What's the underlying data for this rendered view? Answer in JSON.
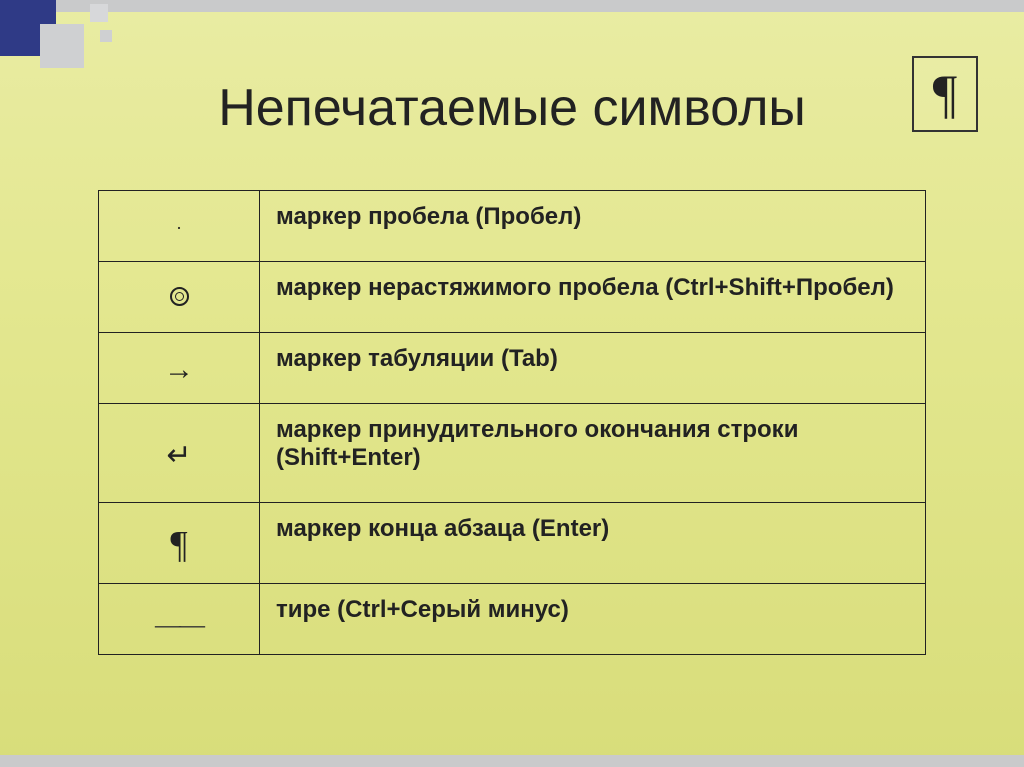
{
  "title": "Непечатаемые символы",
  "pilcrow_frame": "¶",
  "rows": [
    {
      "symbol": "·",
      "symClass": "small-dot",
      "desc": "маркер пробела (Пробел)"
    },
    {
      "symbol": "◎",
      "useRing": true,
      "symClass": "circle",
      "desc": "маркер нерастяжимого пробела (Ctrl+Shift+Пробел)"
    },
    {
      "symbol": "→",
      "symClass": "arrow",
      "desc": "маркер табуляции (Tab)"
    },
    {
      "symbol": "↵",
      "symClass": "ret",
      "desc": "маркер принудительного окончания строки (Shift+Enter)"
    },
    {
      "symbol": "¶",
      "symClass": "pil",
      "desc": "маркер конца абзаца (Enter)"
    },
    {
      "symbol": "——",
      "symClass": "dash",
      "desc": "тире (Ctrl+Серый минус)"
    }
  ]
}
